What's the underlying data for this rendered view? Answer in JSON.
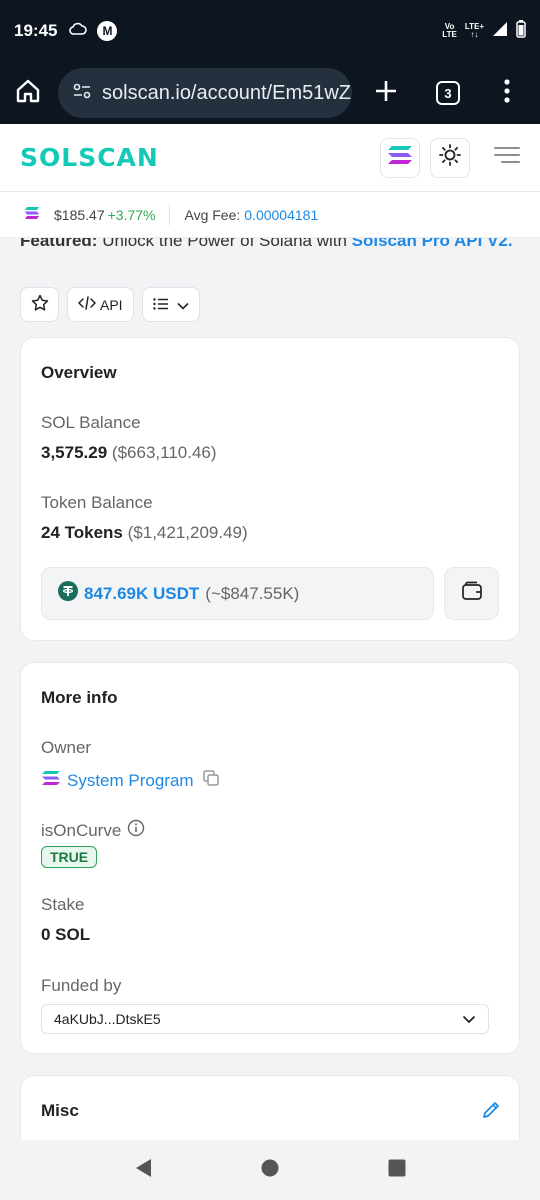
{
  "status": {
    "time": "19:45",
    "network_top": "Vo",
    "network_bottom": "LTE",
    "lte_top": "LTE+",
    "lte_bottom": "↑↓",
    "moto": "M"
  },
  "browser": {
    "url": "solscan.io/account/Em51wZ",
    "tab_count": "3"
  },
  "site": {
    "logo": "SOLSCAN"
  },
  "price": {
    "sol_price": "$185.47",
    "change": "+3.77%",
    "fee_label": "Avg Fee:",
    "fee_value": "0.00004181"
  },
  "featured": {
    "prefix": "Featured:",
    "text": " Unlock the Power of Solana with ",
    "link": "Solscan Pro API V2."
  },
  "actions": {
    "api_label": "API"
  },
  "overview": {
    "title": "Overview",
    "sol_balance_label": "SOL Balance",
    "sol_balance": "3,575.29",
    "sol_balance_usd": "($663,110.46)",
    "token_balance_label": "Token Balance",
    "token_count": "24 Tokens",
    "token_usd": "($1,421,209.49)",
    "token_amount": "847.69K USDT",
    "token_amount_usd": "(~$847.55K)"
  },
  "more_info": {
    "title": "More info",
    "owner_label": "Owner",
    "owner_value": "System Program",
    "oncurve_label": "isOnCurve",
    "oncurve_value": "TRUE",
    "stake_label": "Stake",
    "stake_value": "0 SOL",
    "funded_label": "Funded by",
    "funded_value": "4aKUbJ...DtskE5"
  },
  "misc": {
    "title": "Misc"
  },
  "colors": {
    "accent": "#1e88e5",
    "brand": "#14c9b5",
    "positive": "#2eab56"
  }
}
